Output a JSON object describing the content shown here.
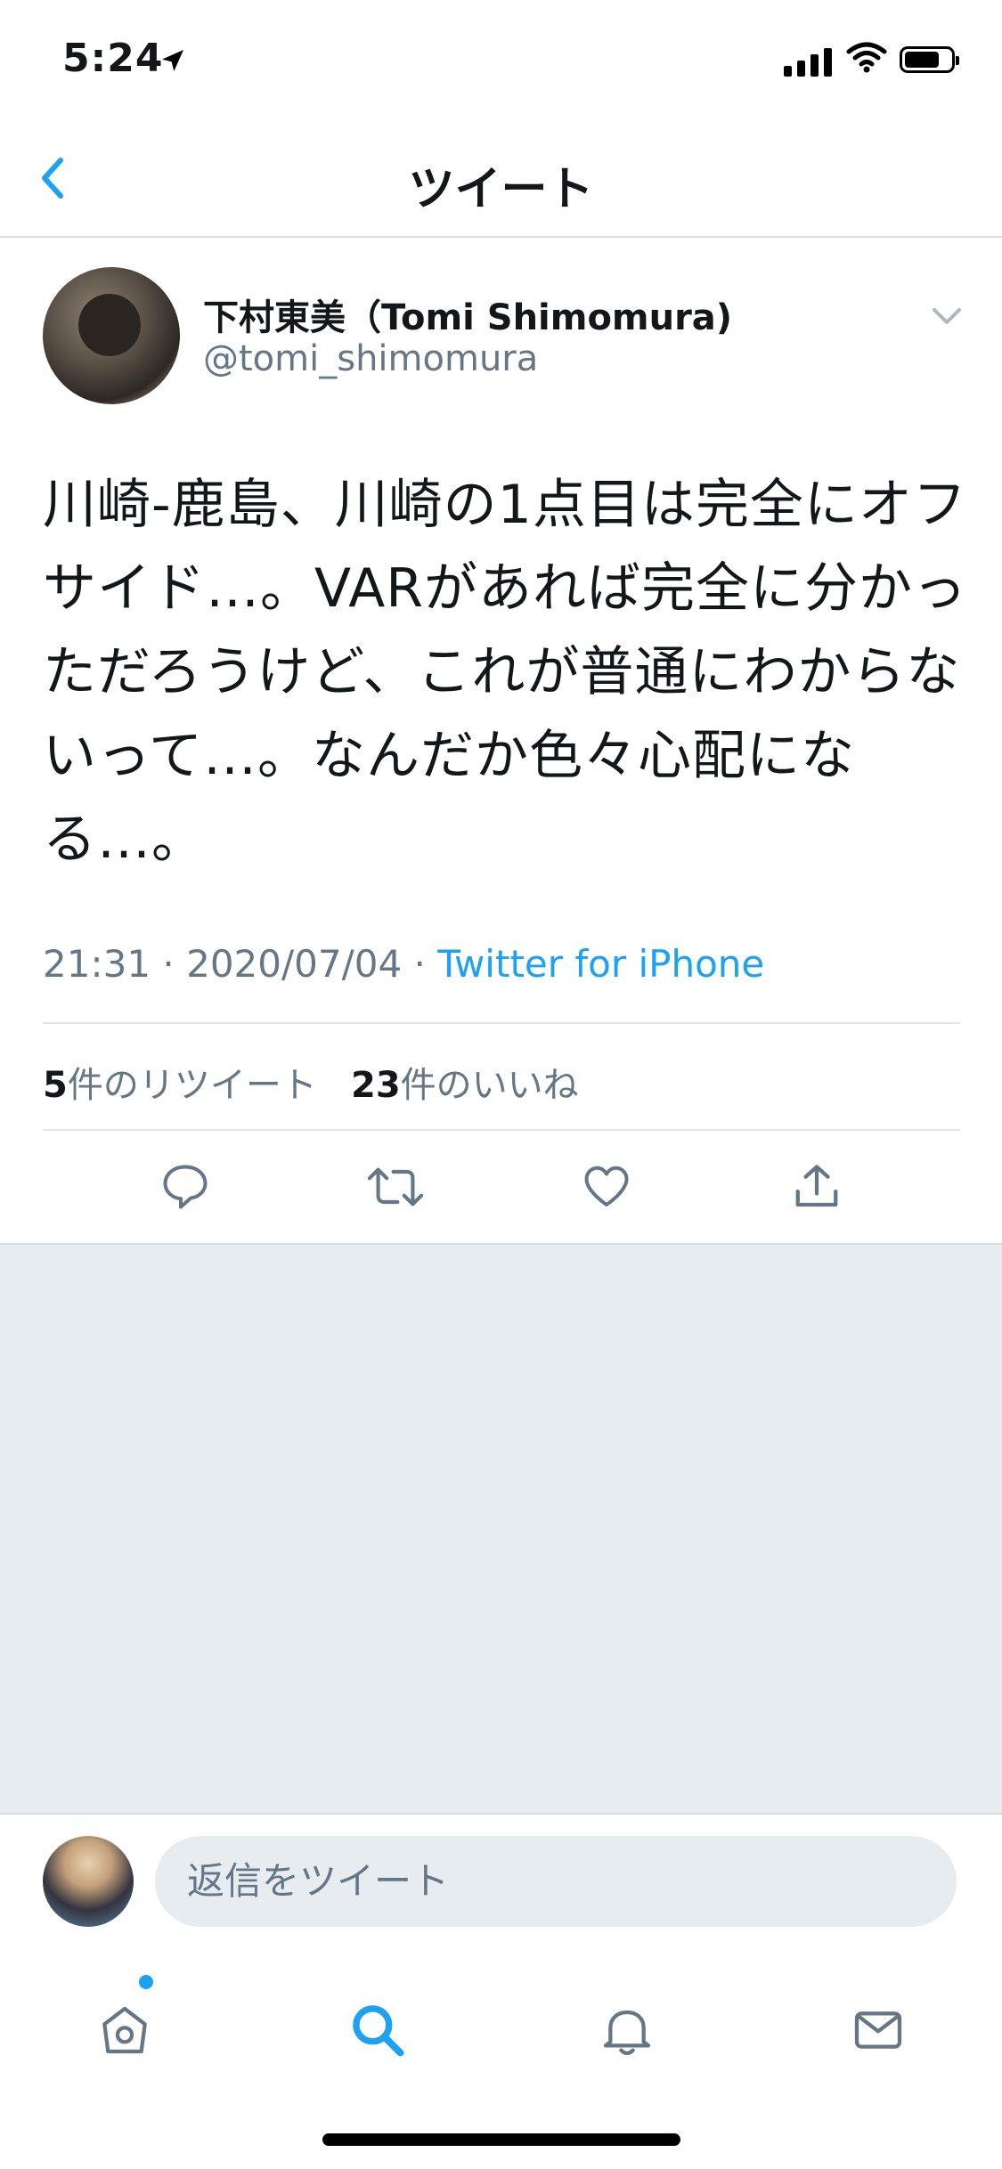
{
  "status_bar": {
    "time": "5:24"
  },
  "nav": {
    "title": "ツイート"
  },
  "tweet": {
    "author_name": "下村東美（Tomi Shimomura)",
    "author_handle": "@tomi_shimomura",
    "text": "川崎-鹿島、川崎の1点目は完全にオフサイド…。VARがあれば完全に分かっただろうけど、これが普通にわからないって…。なんだか色々心配になる…。",
    "time": "21:31",
    "date": "2020/07/04",
    "source": "Twitter for iPhone",
    "retweet_count": "5",
    "retweet_label": "件のリツイート",
    "like_count": "23",
    "like_label": "件のいいね"
  },
  "reply": {
    "placeholder": "返信をツイート"
  },
  "colors": {
    "accent": "#1da1f2",
    "muted": "#657786",
    "background_gray": "#e6ecf0"
  },
  "icons": {
    "status": [
      "location-arrow-icon",
      "signal-icon",
      "wifi-icon",
      "battery-icon"
    ],
    "actions": [
      "reply-icon",
      "retweet-icon",
      "like-icon",
      "share-icon"
    ],
    "tabs": [
      "home-icon",
      "search-icon",
      "notifications-icon",
      "messages-icon"
    ]
  }
}
